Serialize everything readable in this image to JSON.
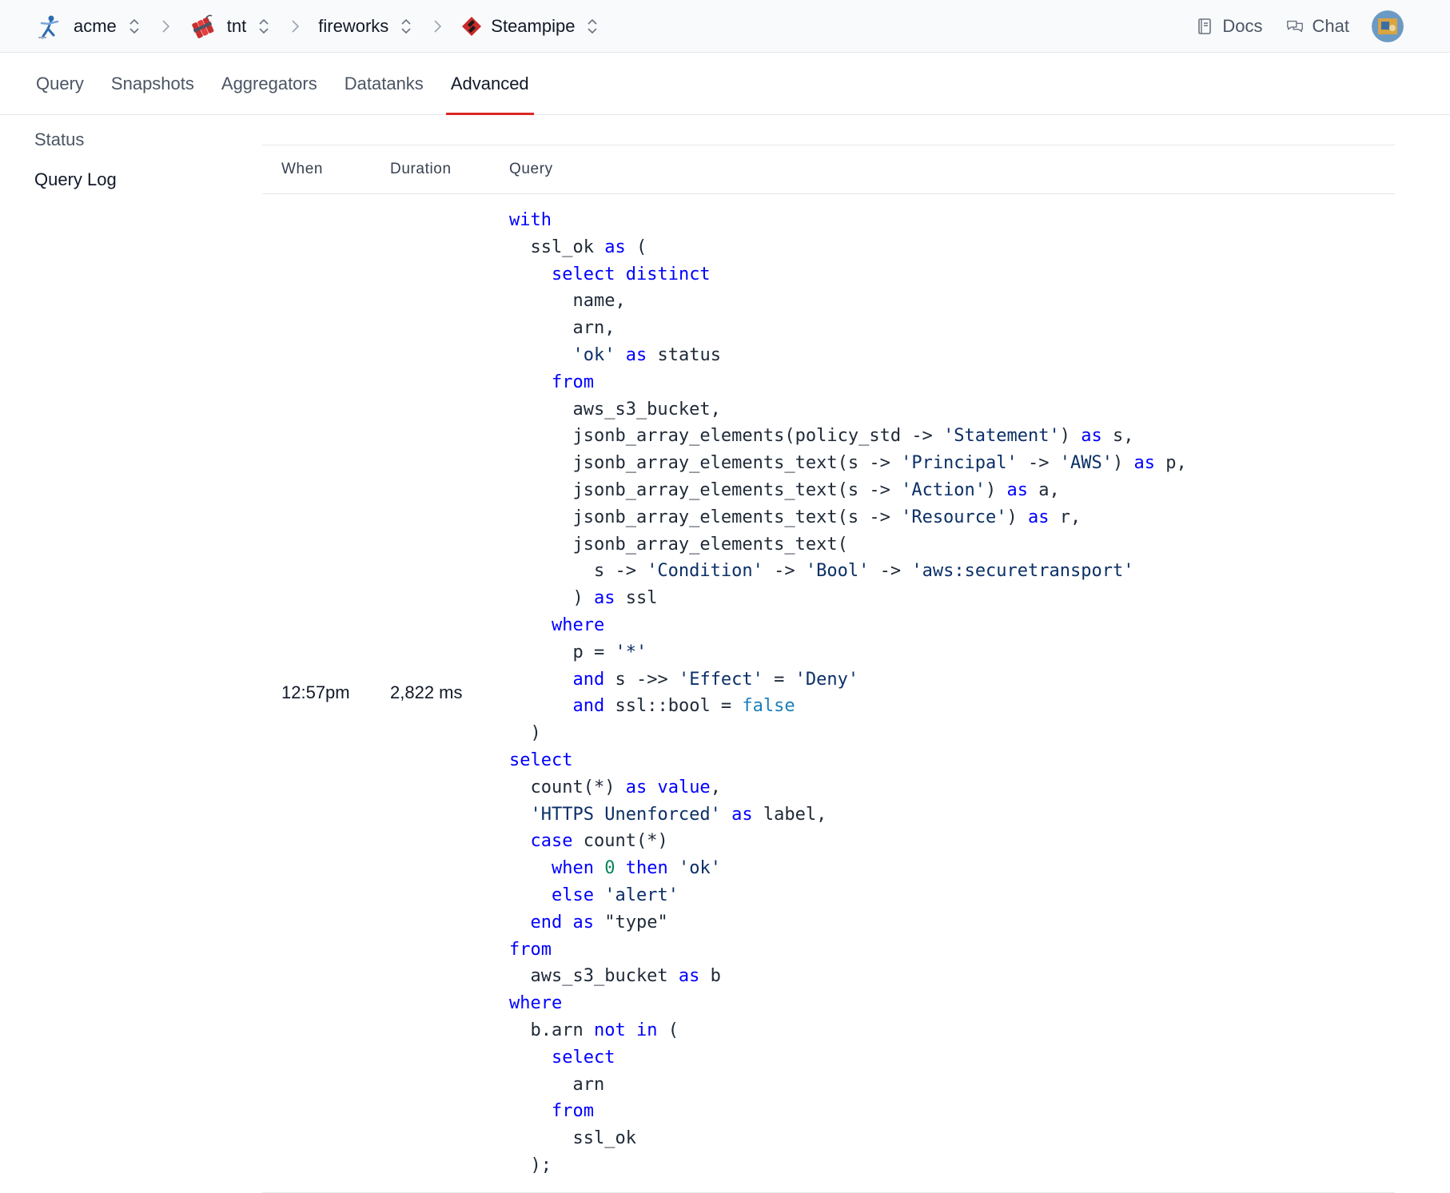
{
  "topbar": {
    "crumbs": [
      {
        "label": "acme",
        "icon": "acme-logo-icon"
      },
      {
        "label": "tnt",
        "icon": "tnt-logo-icon"
      },
      {
        "label": "fireworks",
        "icon": ""
      },
      {
        "label": "Steampipe",
        "icon": "steampipe-logo-icon"
      }
    ],
    "docs_label": "Docs",
    "chat_label": "Chat"
  },
  "tabs": [
    "Query",
    "Snapshots",
    "Aggregators",
    "Datatanks",
    "Advanced"
  ],
  "active_tab": "Advanced",
  "sidenav": [
    "Status",
    "Query Log"
  ],
  "active_sidenav": "Query Log",
  "table": {
    "headers": {
      "when": "When",
      "duration": "Duration",
      "query": "Query"
    },
    "rows": [
      {
        "when": "12:57pm",
        "duration": "2,822 ms",
        "query": "with\n  ssl_ok as (\n    select distinct\n      name,\n      arn,\n      'ok' as status\n    from\n      aws_s3_bucket,\n      jsonb_array_elements(policy_std -> 'Statement') as s,\n      jsonb_array_elements_text(s -> 'Principal' -> 'AWS') as p,\n      jsonb_array_elements_text(s -> 'Action') as a,\n      jsonb_array_elements_text(s -> 'Resource') as r,\n      jsonb_array_elements_text(\n        s -> 'Condition' -> 'Bool' -> 'aws:securetransport'\n      ) as ssl\n    where\n      p = '*'\n      and s ->> 'Effect' = 'Deny'\n      and ssl::bool = false\n  )\nselect\n  count(*) as value,\n  'HTTPS Unenforced' as label,\n  case count(*)\n    when 0 then 'ok'\n    else 'alert'\n  end as \"type\"\nfrom\n  aws_s3_bucket as b\nwhere\n  b.arn not in (\n    select\n      arn\n    from\n      ssl_ok\n  );"
      }
    ]
  },
  "colors": {
    "keyword": "#0000ff",
    "string": "#0b2f66",
    "number": "#098658",
    "literal": "#1a7fb8",
    "active_tab_underline": "#dc2626"
  }
}
